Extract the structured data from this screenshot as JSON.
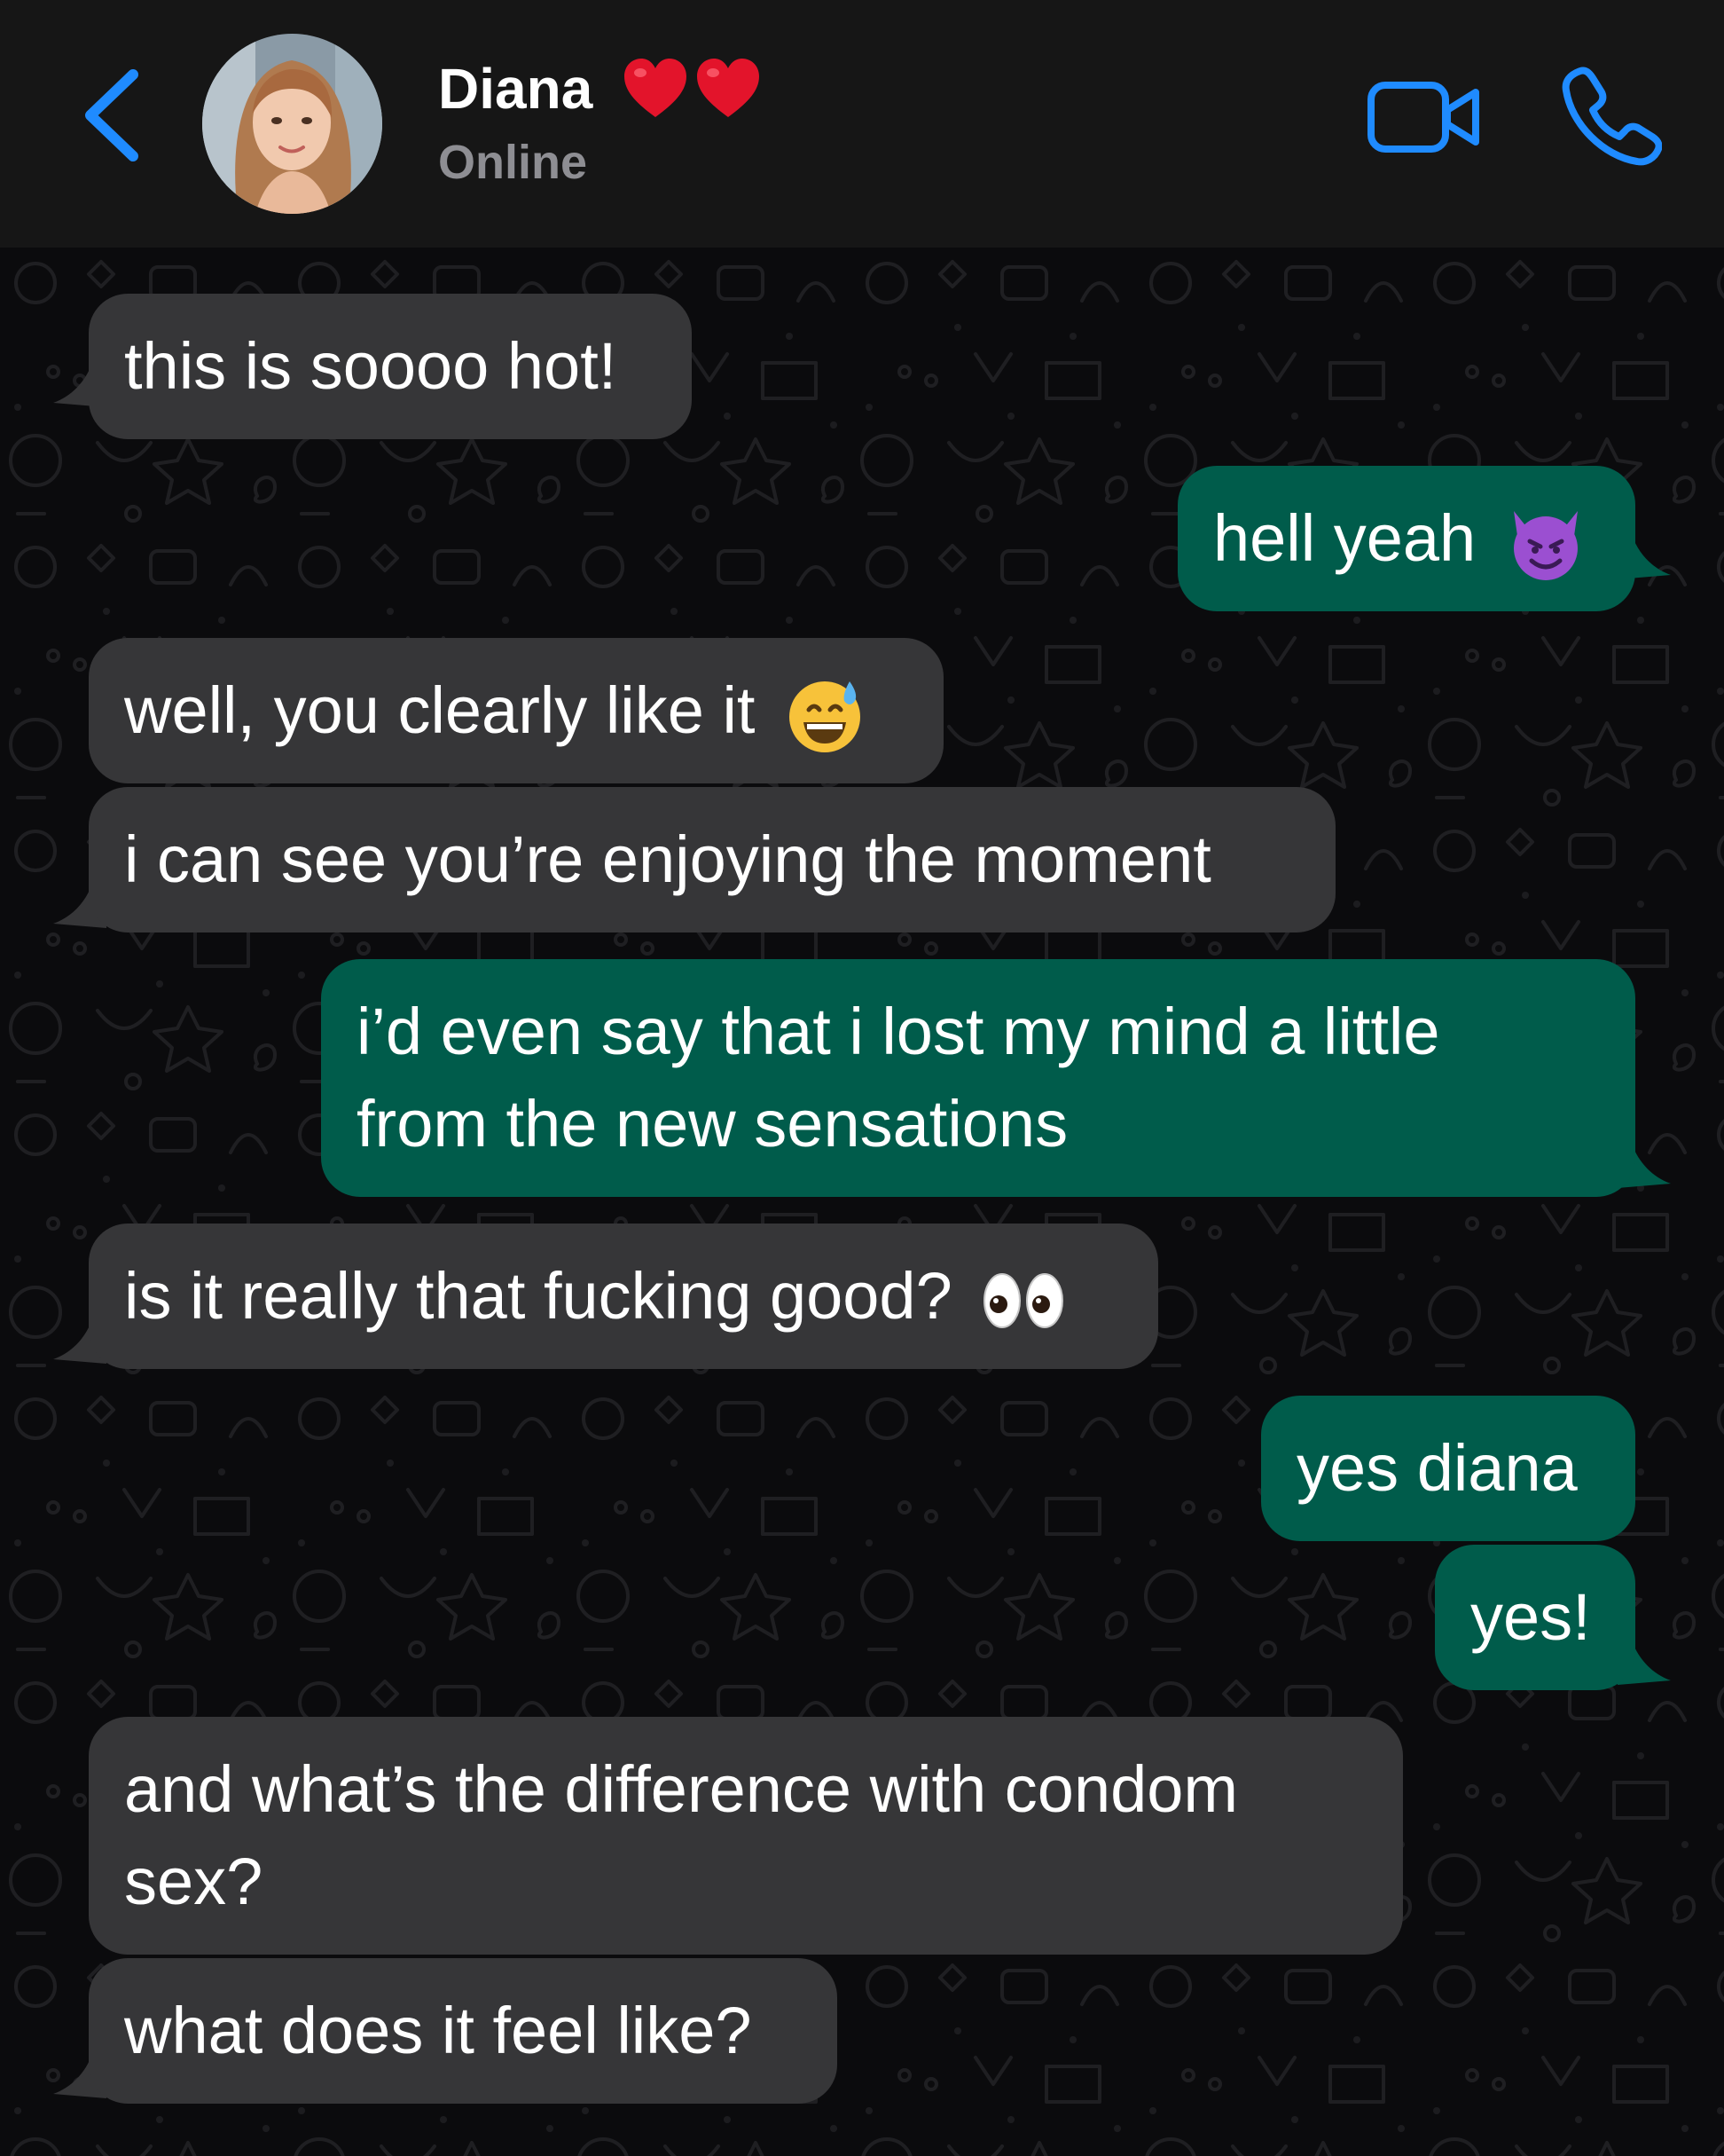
{
  "header": {
    "back_label": "Back",
    "contact_name": "Diana",
    "hearts_icon": "heart-emoji",
    "status": "Online",
    "accent_color": "#1f8bff"
  },
  "messages": [
    {
      "direction": "in",
      "text": "this is soooo hot!"
    },
    {
      "direction": "out",
      "text": "hell yeah",
      "emoji": "smiling-devil"
    },
    {
      "direction": "in",
      "text": "well, you clearly like it",
      "emoji": "grinning-sweat"
    },
    {
      "direction": "in",
      "text": "i can see you’re enjoying the moment"
    },
    {
      "direction": "out",
      "lines": [
        "i’d even say that i lost my mind a little",
        "from the new sensations"
      ]
    },
    {
      "direction": "in",
      "text": "is it really that fucking good?",
      "emoji": "eyes"
    },
    {
      "direction": "out",
      "text": "yes diana"
    },
    {
      "direction": "out",
      "text": "yes!"
    },
    {
      "direction": "in",
      "lines": [
        "and what’s the difference with condom",
        "sex?"
      ]
    },
    {
      "direction": "in",
      "text": "what does it feel like?"
    }
  ],
  "colors": {
    "incoming_bubble": "#363638",
    "outgoing_bubble": "#005c4b",
    "background": "#0b0b0d"
  }
}
